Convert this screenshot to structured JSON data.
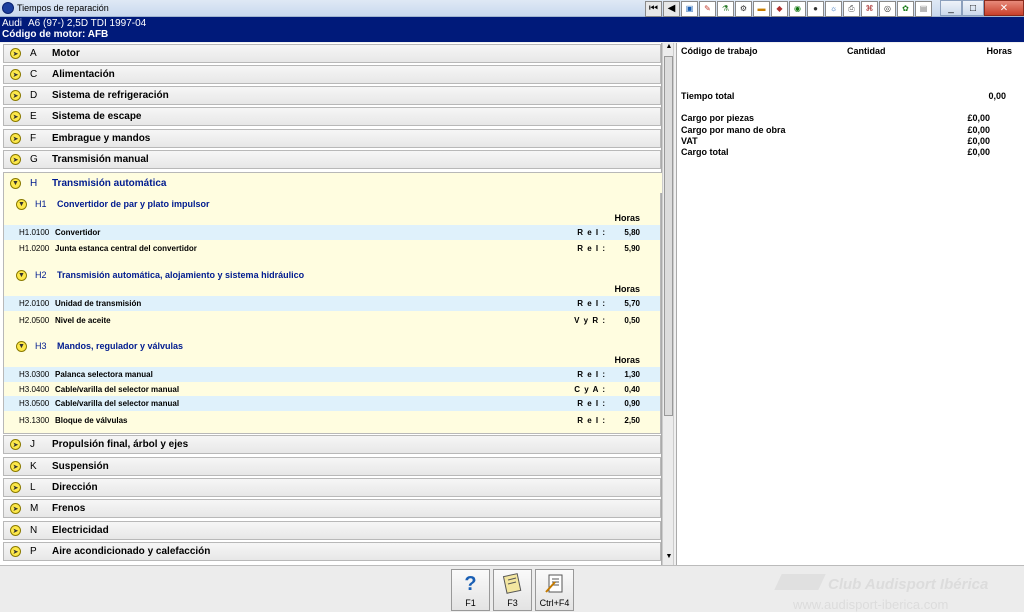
{
  "window": {
    "title": "Tiempos de reparación"
  },
  "header": {
    "make": "Audi",
    "model": "A6 (97-) 2,5D TDI 1997-04",
    "engine_code": "Código de motor: AFB"
  },
  "toolbar": {
    "icons": [
      "first-page-icon",
      "prev-page-icon",
      "vehicle-icon",
      "tools-icon",
      "lubricant-icon",
      "engine-icon",
      "battery-icon",
      "belt-icon",
      "car-front-icon",
      "tire-icon",
      "settings-icon",
      "printer-icon",
      "diagram-icon",
      "camera-icon",
      "wheel-icon",
      "document-icon",
      "minimize-icon",
      "maximize-icon",
      "close-icon"
    ]
  },
  "categories_top": [
    {
      "code": "A",
      "name": "Motor"
    },
    {
      "code": "C",
      "name": "Alimentación"
    },
    {
      "code": "D",
      "name": "Sistema de refrigeración"
    },
    {
      "code": "E",
      "name": "Sistema de escape"
    },
    {
      "code": "F",
      "name": "Embrague y mandos"
    },
    {
      "code": "G",
      "name": "Transmisión manual"
    }
  ],
  "expanded": {
    "code": "H",
    "name": "Transmisión automática",
    "groups": [
      {
        "code": "H1",
        "name": "Convertidor de par y plato impulsor",
        "horas": "Horas",
        "items": [
          {
            "code": "H1.0100",
            "name": "Convertidor",
            "op": "R e I :",
            "hours": "5,80"
          },
          {
            "code": "H1.0200",
            "name": "Junta estanca central del convertidor",
            "op": "R e I :",
            "hours": "5,90"
          }
        ]
      },
      {
        "code": "H2",
        "name": "Transmisión automática, alojamiento y sistema hidráulico",
        "horas": "Horas",
        "items": [
          {
            "code": "H2.0100",
            "name": "Unidad de transmisión",
            "op": "R e I :",
            "hours": "5,70"
          },
          {
            "code": "H2.0500",
            "name": "Nivel de aceite",
            "op": "V y R :",
            "hours": "0,50"
          }
        ]
      },
      {
        "code": "H3",
        "name": "Mandos, regulador y válvulas",
        "horas": "Horas",
        "items": [
          {
            "code": "H3.0300",
            "name": "Palanca selectora manual",
            "op": "R e I :",
            "hours": "1,30"
          },
          {
            "code": "H3.0400",
            "name": "Cable/varilla del selector manual",
            "op": "C y A :",
            "hours": "0,40"
          },
          {
            "code": "H3.0500",
            "name": "Cable/varilla del selector manual",
            "op": "R e I :",
            "hours": "0,90"
          },
          {
            "code": "H3.1300",
            "name": "Bloque de válvulas",
            "op": "R e I :",
            "hours": "2,50"
          }
        ]
      }
    ]
  },
  "categories_bottom": [
    {
      "code": "J",
      "name": "Propulsión final, árbol y ejes"
    },
    {
      "code": "K",
      "name": "Suspensión"
    },
    {
      "code": "L",
      "name": "Dirección"
    },
    {
      "code": "M",
      "name": "Frenos"
    },
    {
      "code": "N",
      "name": "Electricidad"
    },
    {
      "code": "P",
      "name": "Aire acondicionado y calefacción"
    }
  ],
  "summary": {
    "col_code": "Código de trabajo",
    "col_qty": "Cantidad",
    "col_hours": "Horas",
    "total_time_label": "Tiempo total",
    "total_time": "0,00",
    "parts_label": "Cargo por piezas",
    "parts": "£0,00",
    "labour_label": "Cargo por mano de obra",
    "labour": "£0,00",
    "vat_label": "VAT",
    "vat": "£0,00",
    "total_label": "Cargo total",
    "total": "£0,00"
  },
  "footer": {
    "f1": "F1",
    "f3": "F3",
    "ctrlf4": "Ctrl+F4"
  },
  "watermark": {
    "line1": "Club Audisport Ibérica",
    "line2": "www.audisport-iberica.com"
  }
}
